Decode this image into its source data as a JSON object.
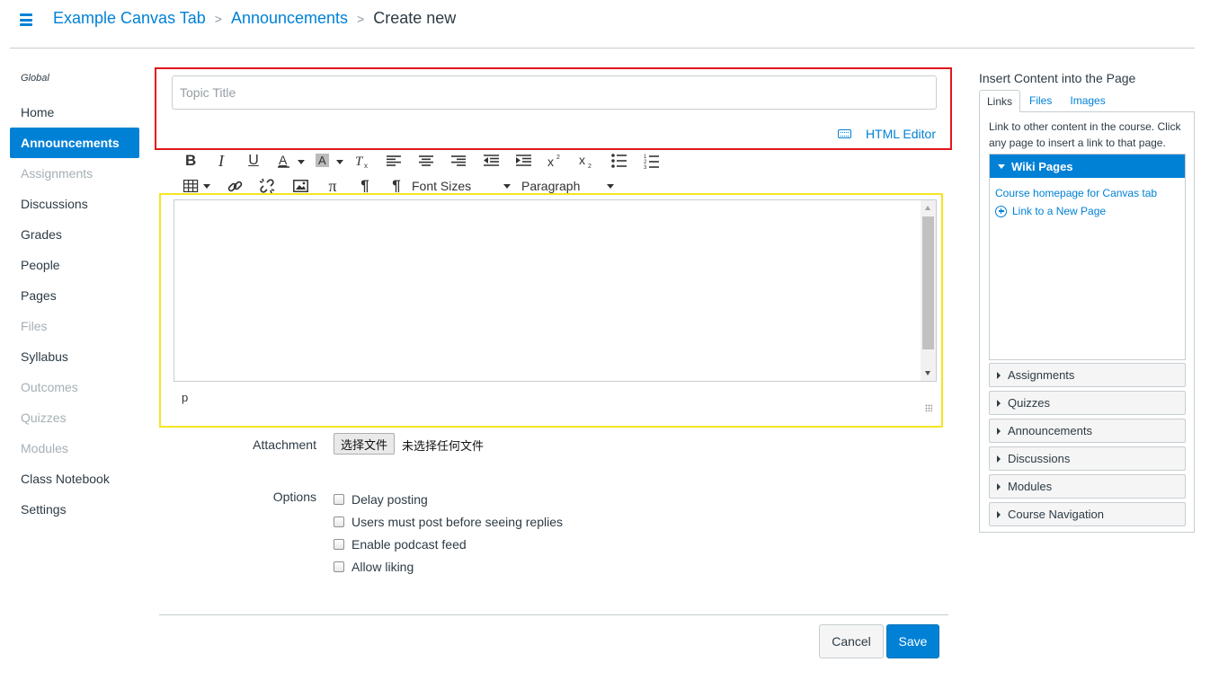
{
  "header": {
    "breadcrumb": [
      "Example Canvas Tab",
      "Announcements"
    ],
    "current": "Create new",
    "separator": ">",
    "accent_color": "#0081d6"
  },
  "nav": {
    "group_label": "Global",
    "items": [
      {
        "label": "Home",
        "state": "normal"
      },
      {
        "label": "Announcements",
        "state": "active"
      },
      {
        "label": "Assignments",
        "state": "disabled"
      },
      {
        "label": "Discussions",
        "state": "normal"
      },
      {
        "label": "Grades",
        "state": "normal"
      },
      {
        "label": "People",
        "state": "normal"
      },
      {
        "label": "Pages",
        "state": "normal"
      },
      {
        "label": "Files",
        "state": "disabled"
      },
      {
        "label": "Syllabus",
        "state": "normal"
      },
      {
        "label": "Outcomes",
        "state": "disabled"
      },
      {
        "label": "Quizzes",
        "state": "disabled"
      },
      {
        "label": "Modules",
        "state": "disabled"
      },
      {
        "label": "Class Notebook",
        "state": "normal"
      },
      {
        "label": "Settings",
        "state": "normal"
      }
    ]
  },
  "form": {
    "title_placeholder": "Topic Title",
    "title_value": "",
    "html_editor_label": "HTML Editor",
    "font_sizes_label": "Font Sizes",
    "paragraph_label": "Paragraph",
    "status_path": "p",
    "attachment_label": "Attachment",
    "file_button_label": "选择文件",
    "file_status": "未选择任何文件",
    "options_label": "Options",
    "options": [
      {
        "label": "Delay posting",
        "checked": false
      },
      {
        "label": "Users must post before seeing replies",
        "checked": false
      },
      {
        "label": "Enable podcast feed",
        "checked": false
      },
      {
        "label": "Allow liking",
        "checked": false
      }
    ],
    "cancel_label": "Cancel",
    "save_label": "Save"
  },
  "sidebar": {
    "title": "Insert Content into the Page",
    "tabs": [
      "Links",
      "Files",
      "Images"
    ],
    "active_tab": "Links",
    "description": "Link to other content in the course. Click any page to insert a link to that page.",
    "wiki_header": "Wiki Pages",
    "wiki_links": [
      "Course homepage for Canvas tab"
    ],
    "new_page_label": "Link to a New Page",
    "sections": [
      "Assignments",
      "Quizzes",
      "Announcements",
      "Discussions",
      "Modules",
      "Course Navigation"
    ]
  },
  "icons": {
    "toolbar_row1": [
      "bold-icon",
      "italic-icon",
      "underline-icon",
      "text-color-icon",
      "background-color-icon",
      "clear-formatting-icon",
      "align-left-icon",
      "align-center-icon",
      "align-right-icon",
      "outdent-icon",
      "indent-icon",
      "superscript-icon",
      "subscript-icon",
      "bullet-list-icon",
      "numbered-list-icon"
    ],
    "toolbar_row2": [
      "table-icon",
      "link-icon",
      "unlink-icon",
      "image-icon",
      "math-icon",
      "ltr-icon",
      "rtl-icon"
    ]
  }
}
